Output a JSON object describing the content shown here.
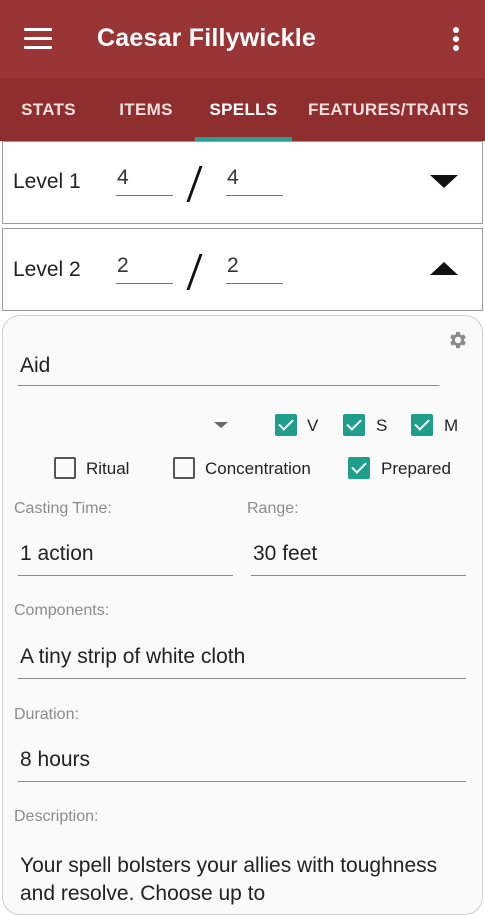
{
  "appbar": {
    "title": "Caesar Fillywickle"
  },
  "tabs": [
    {
      "label": "STATS"
    },
    {
      "label": "ITEMS"
    },
    {
      "label": "SPELLS"
    },
    {
      "label": "FEATURES/TRAITS"
    }
  ],
  "active_tab": "SPELLS",
  "accent_color": "#1f9e8c",
  "appbar_color": "#9a3535",
  "levels": [
    {
      "label": "Level 1",
      "current": "4",
      "max": "4",
      "expanded": false
    },
    {
      "label": "Level 2",
      "current": "2",
      "max": "2",
      "expanded": true
    }
  ],
  "spell": {
    "name": "Aid",
    "components_flags": [
      {
        "label": "V",
        "checked": true
      },
      {
        "label": "S",
        "checked": true
      },
      {
        "label": "M",
        "checked": true
      }
    ],
    "options": [
      {
        "label": "Ritual",
        "checked": false
      },
      {
        "label": "Concentration",
        "checked": false
      },
      {
        "label": "Prepared",
        "checked": true
      }
    ],
    "casting_time_label": "Casting Time:",
    "casting_time": "1 action",
    "range_label": "Range:",
    "range": "30 feet",
    "components_label": "Components:",
    "components": "A tiny strip of white cloth",
    "duration_label": "Duration:",
    "duration": "8 hours",
    "description_label": "Description:",
    "description": "Your spell bolsters your allies with toughness and resolve. Choose up to"
  }
}
